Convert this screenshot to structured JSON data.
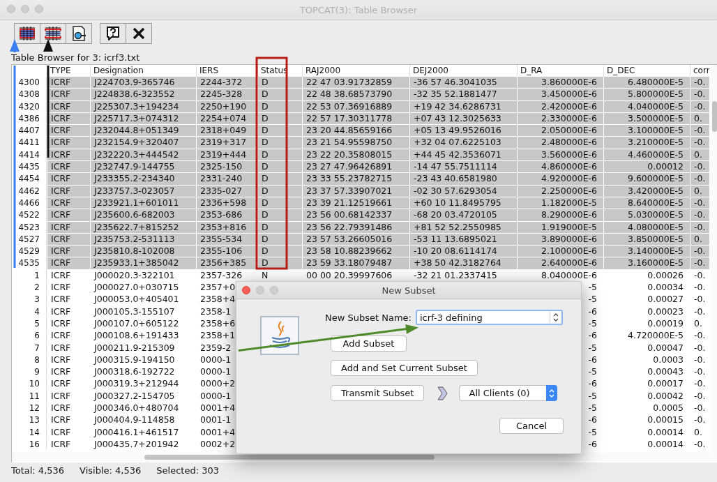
{
  "window": {
    "title": "TOPCAT(3): Table Browser"
  },
  "browser_label": "Table Browser for 3: icrf3.txt",
  "table": {
    "columns": [
      "",
      "TYPE",
      "Designation",
      "IERS",
      "Status",
      "RAJ2000",
      "DEJ2000",
      "D_RA",
      "D_DEC",
      "corr"
    ],
    "rows": [
      {
        "selected": true,
        "cells": [
          "4300",
          "ICRF",
          "J224703.9-365746",
          "2244-372",
          "D",
          "22 47 03.91732859",
          "-36 57 46.3041035",
          "3.860000E-6",
          "6.480000E-5",
          "-0."
        ]
      },
      {
        "selected": true,
        "cells": [
          "4308",
          "ICRF",
          "J224838.6-323552",
          "2245-328",
          "D",
          "22 48 38.68573790",
          "-32 35 52.1881477",
          "3.450000E-6",
          "5.800000E-5",
          "-0."
        ]
      },
      {
        "selected": true,
        "cells": [
          "4320",
          "ICRF",
          "J225307.3+194234",
          "2250+190",
          "D",
          "22 53 07.36916889",
          "+19 42 34.6286731",
          "2.420000E-6",
          "4.040000E-5",
          "-0."
        ]
      },
      {
        "selected": true,
        "cells": [
          "4386",
          "ICRF",
          "J225717.3+074312",
          "2254+074",
          "D",
          "22 57 17.30311778",
          "+07 43 12.3025633",
          "2.330000E-6",
          "3.500000E-5",
          "0."
        ]
      },
      {
        "selected": true,
        "cells": [
          "4407",
          "ICRF",
          "J232044.8+051349",
          "2318+049",
          "D",
          "23 20 44.85659166",
          "+05 13 49.9526016",
          "2.050000E-6",
          "3.100000E-5",
          "-0."
        ]
      },
      {
        "selected": true,
        "cells": [
          "4411",
          "ICRF",
          "J232154.9+320407",
          "2319+317",
          "D",
          "23 21 54.95598750",
          "+32 04 07.6225103",
          "2.480000E-6",
          "3.210000E-5",
          "-0."
        ]
      },
      {
        "selected": true,
        "cells": [
          "4414",
          "ICRF",
          "J232220.3+444542",
          "2319+444",
          "D",
          "23 22 20.35808015",
          "+44 45 42.3536071",
          "3.560000E-6",
          "4.460000E-5",
          "0."
        ]
      },
      {
        "selected": true,
        "cells": [
          "4435",
          "ICRF",
          "J232747.9-144755",
          "2325-150",
          "D",
          "23 27 47.96426891",
          "-14 47 55.7511114",
          "4.860000E-6",
          "0.00012",
          "-0."
        ]
      },
      {
        "selected": true,
        "cells": [
          "4454",
          "ICRF",
          "J233355.2-234340",
          "2331-240",
          "D",
          "23 33 55.23782715",
          "-23 43 40.6581980",
          "4.920000E-6",
          "9.600000E-5",
          "-0."
        ]
      },
      {
        "selected": true,
        "cells": [
          "4462",
          "ICRF",
          "J233757.3-023057",
          "2335-027",
          "D",
          "23 37 57.33907021",
          "-02 30 57.6293054",
          "2.250000E-6",
          "3.420000E-5",
          "0."
        ]
      },
      {
        "selected": true,
        "cells": [
          "4466",
          "ICRF",
          "J233921.1+601011",
          "2336+598",
          "D",
          "23 39 21.12519661",
          "+60 10 11.8495795",
          "1.182000E-5",
          "8.640000E-5",
          "-0."
        ]
      },
      {
        "selected": true,
        "cells": [
          "4522",
          "ICRF",
          "J235600.6-682003",
          "2353-686",
          "D",
          "23 56 00.68142337",
          "-68 20 03.4720105",
          "8.290000E-6",
          "5.030000E-5",
          "-0."
        ]
      },
      {
        "selected": true,
        "cells": [
          "4523",
          "ICRF",
          "J235622.7+815252",
          "2353+816",
          "D",
          "23 56 22.79391486",
          "+81 52 52.2550985",
          "1.919000E-5",
          "4.080000E-5",
          "-0."
        ]
      },
      {
        "selected": true,
        "cells": [
          "4527",
          "ICRF",
          "J235753.2-531113",
          "2355-534",
          "D",
          "23 57 53.26605016",
          "-53 11 13.6895021",
          "3.890000E-6",
          "3.850000E-5",
          "0."
        ]
      },
      {
        "selected": true,
        "cells": [
          "4529",
          "ICRF",
          "J235810.8-102008",
          "2355-106",
          "D",
          "23 58 10.88239662",
          "-10 20 08.6114174",
          "2.100000E-6",
          "3.140000E-5",
          "-0."
        ]
      },
      {
        "selected": true,
        "cells": [
          "4535",
          "ICRF",
          "J235933.1+385042",
          "2356+385",
          "D",
          "23 59 33.18079487",
          "+38 50 42.3182764",
          "2.640000E-6",
          "3.160000E-5",
          "-0."
        ]
      },
      {
        "selected": false,
        "cells": [
          "1",
          "ICRF",
          "J000020.3-322101",
          "2357-326",
          "N",
          "00 00 20.39997606",
          "-32 21 01.2337415",
          "8.040000E-6",
          "0.00026",
          "-0."
        ]
      }
    ],
    "rows_behind_dialog": [
      {
        "selected": false,
        "cells": [
          "2",
          "ICRF",
          "J000027.0+030715",
          "2357+0",
          "-5",
          "0.00034",
          "-0."
        ]
      },
      {
        "selected": false,
        "cells": [
          "3",
          "ICRF",
          "J000053.0+405401",
          "2358+4",
          "-5",
          "0.00027",
          "-0."
        ]
      },
      {
        "selected": false,
        "cells": [
          "4",
          "ICRF",
          "J000105.3-155107",
          "2358-1",
          "-6",
          "0.00023",
          "-0."
        ]
      },
      {
        "selected": false,
        "cells": [
          "5",
          "ICRF",
          "J000107.0+605122",
          "2358+6",
          "-5",
          "0.00019",
          "0."
        ]
      },
      {
        "selected": false,
        "cells": [
          "6",
          "ICRF",
          "J000108.6+191433",
          "2358+1",
          "-6",
          "4.720000E-5",
          "-0."
        ]
      },
      {
        "selected": false,
        "cells": [
          "7",
          "ICRF",
          "J000211.9-215309",
          "2359-2",
          "-5",
          "0.00047",
          "-0."
        ]
      },
      {
        "selected": false,
        "cells": [
          "8",
          "ICRF",
          "J000315.9-194150",
          "0000-1",
          "-6",
          "0.0003",
          "-0."
        ]
      },
      {
        "selected": false,
        "cells": [
          "9",
          "ICRF",
          "J000318.6-192722",
          "0000-1",
          "-5",
          "0.00043",
          "-0."
        ]
      },
      {
        "selected": false,
        "cells": [
          "10",
          "ICRF",
          "J000319.3+212944",
          "0000+2",
          "-6",
          "0.00017",
          "-0."
        ]
      },
      {
        "selected": false,
        "cells": [
          "11",
          "ICRF",
          "J000327.2-154705",
          "0000-1",
          "-5",
          "0.00042",
          "-0."
        ]
      },
      {
        "selected": false,
        "cells": [
          "12",
          "ICRF",
          "J000346.0+480704",
          "0001+4",
          "-5",
          "0.0005",
          "-0."
        ]
      },
      {
        "selected": false,
        "cells": [
          "13",
          "ICRF",
          "J000404.9-114858",
          "0001-1",
          "-6",
          "0.00015",
          "-0."
        ]
      },
      {
        "selected": false,
        "cells": [
          "14",
          "ICRF",
          "J000416.1+461517",
          "0001+4",
          "-5",
          "0.00014",
          "0."
        ]
      },
      {
        "selected": false,
        "cells": [
          "16",
          "ICRF",
          "J000435.7+201942",
          "0002+2",
          "-6",
          "0.00014",
          "-0."
        ]
      }
    ]
  },
  "status_bar": [
    "Total: 4,536",
    "Visible: 4,536",
    "Selected: 303"
  ],
  "dialog": {
    "title": "New Subset",
    "name_label": "New Subset Name:",
    "name_value": "icrf-3 defining",
    "add_button": "Add Subset",
    "add_set_button": "Add and Set Current Subset",
    "transmit_button": "Transmit Subset",
    "target": "All Clients (0)",
    "cancel_button": "Cancel"
  }
}
